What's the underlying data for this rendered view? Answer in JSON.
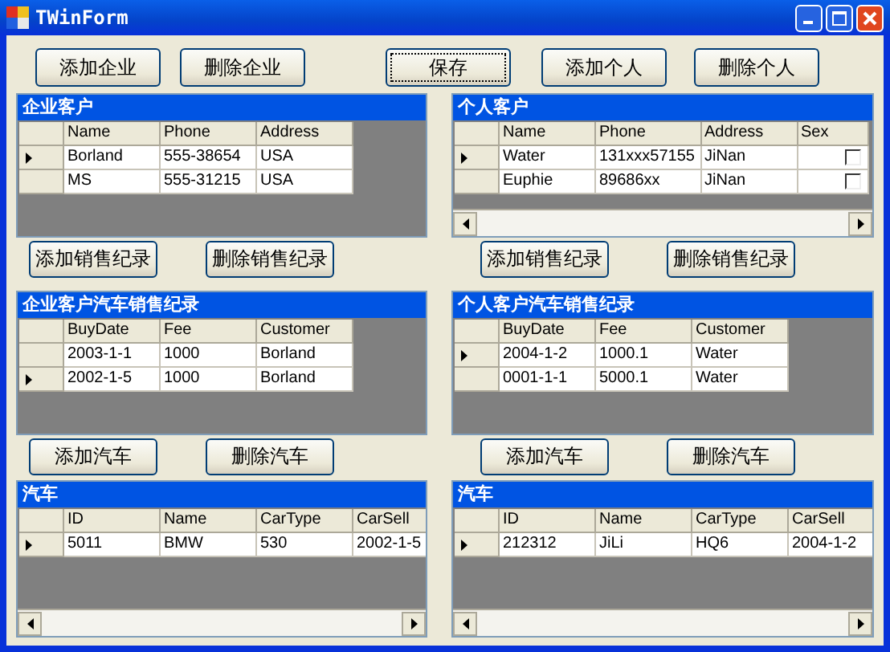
{
  "window": {
    "title": "TWinForm"
  },
  "toolbar": [
    {
      "label": "添加企业",
      "focused": false
    },
    {
      "label": "删除企业",
      "focused": false
    },
    {
      "label": "保存",
      "focused": true
    },
    {
      "label": "添加个人",
      "focused": false
    },
    {
      "label": "删除个人",
      "focused": false
    }
  ],
  "panels": [
    {
      "title": "企业客户",
      "columns": [
        {
          "label": "Name",
          "kind": "text"
        },
        {
          "label": "Phone",
          "kind": "text"
        },
        {
          "label": "Address",
          "kind": "text"
        }
      ],
      "rows": [
        {
          "current": true,
          "cells": [
            "Borland",
            "555-38654",
            "USA"
          ]
        },
        {
          "current": false,
          "cells": [
            "MS",
            "555-31215",
            "USA"
          ]
        }
      ],
      "actions": [
        "添加销售纪录",
        "删除销售纪录"
      ]
    },
    {
      "title": "个人客户",
      "horizontal_scrollbar": true,
      "columns": [
        {
          "label": "Name",
          "kind": "text"
        },
        {
          "label": "Phone",
          "kind": "text"
        },
        {
          "label": "Address",
          "kind": "text"
        },
        {
          "label": "Sex",
          "kind": "checkbox"
        }
      ],
      "rows": [
        {
          "current": true,
          "cells": [
            "Water",
            "131xxx57155",
            "JiNan",
            false
          ]
        },
        {
          "current": false,
          "cells": [
            "Euphie",
            "89686xx",
            "JiNan",
            false
          ]
        }
      ],
      "actions": [
        "添加销售纪录",
        "删除销售纪录"
      ]
    },
    {
      "title": "企业客户汽车销售纪录",
      "columns": [
        {
          "label": "BuyDate",
          "kind": "text"
        },
        {
          "label": "Fee",
          "kind": "text"
        },
        {
          "label": "Customer",
          "kind": "text"
        }
      ],
      "rows": [
        {
          "current": false,
          "cells": [
            "2003-1-1",
            "1000",
            "Borland"
          ]
        },
        {
          "current": true,
          "cells": [
            "2002-1-5",
            "1000",
            "Borland"
          ]
        }
      ],
      "actions": [
        "添加汽车",
        "删除汽车"
      ]
    },
    {
      "title": "个人客户汽车销售纪录",
      "columns": [
        {
          "label": "BuyDate",
          "kind": "text"
        },
        {
          "label": "Fee",
          "kind": "text"
        },
        {
          "label": "Customer",
          "kind": "text"
        }
      ],
      "rows": [
        {
          "current": true,
          "cells": [
            "2004-1-2",
            "1000.1",
            "Water"
          ]
        },
        {
          "current": false,
          "cells": [
            "0001-1-1",
            "5000.1",
            "Water"
          ]
        }
      ],
      "actions": [
        "添加汽车",
        "删除汽车"
      ]
    },
    {
      "title": "汽车",
      "horizontal_scrollbar": true,
      "columns": [
        {
          "label": "ID",
          "kind": "text"
        },
        {
          "label": "Name",
          "kind": "text"
        },
        {
          "label": "CarType",
          "kind": "text"
        },
        {
          "label": "CarSell",
          "kind": "text"
        }
      ],
      "rows": [
        {
          "current": true,
          "cells": [
            "5011",
            "BMW",
            "530",
            "2002-1-5"
          ]
        }
      ]
    },
    {
      "title": "汽车",
      "horizontal_scrollbar": true,
      "columns": [
        {
          "label": "ID",
          "kind": "text"
        },
        {
          "label": "Name",
          "kind": "text"
        },
        {
          "label": "CarType",
          "kind": "text"
        },
        {
          "label": "CarSell",
          "kind": "text"
        }
      ],
      "rows": [
        {
          "current": true,
          "cells": [
            "212312",
            "JiLi",
            "HQ6",
            "2004-1-2"
          ]
        }
      ]
    }
  ]
}
